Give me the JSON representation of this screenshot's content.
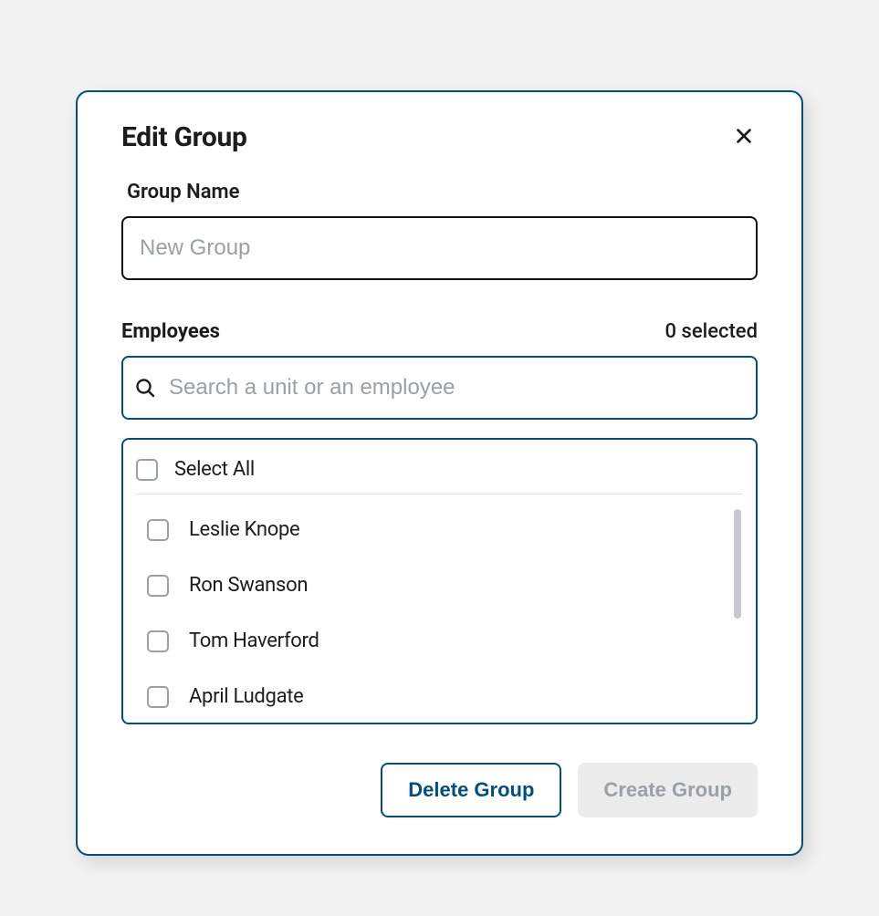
{
  "modal": {
    "title": "Edit Group",
    "groupNameLabel": "Group Name",
    "groupNamePlaceholder": "New Group",
    "groupNameValue": "",
    "employeesLabel": "Employees",
    "selectedText": "0 selected",
    "searchPlaceholder": "Search a unit or an employee",
    "selectAllLabel": "Select All",
    "employees": [
      {
        "name": "Leslie Knope"
      },
      {
        "name": "Ron Swanson"
      },
      {
        "name": "Tom Haverford"
      },
      {
        "name": "April Ludgate"
      }
    ],
    "deleteLabel": "Delete Group",
    "createLabel": "Create Group"
  },
  "icons": {
    "close": "close-icon",
    "search": "search-icon"
  },
  "colors": {
    "primary": "#004f80",
    "text": "#1c1c1c",
    "placeholder": "#9aa0a6",
    "disabledBg": "#ececec"
  }
}
